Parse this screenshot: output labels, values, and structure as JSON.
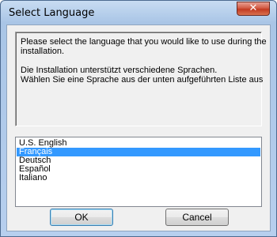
{
  "window": {
    "title": "Select Language",
    "close_glyph": "✕"
  },
  "message": {
    "line1": "Please select the language that you would like to use during the",
    "line2": "installation.",
    "line3": "Die Installation unterstützt verschiedene Sprachen.",
    "line4": "Wählen Sie eine Sprache aus der unten aufgeführten Liste aus"
  },
  "languages": {
    "items": [
      "U.S. English",
      "Français",
      "Deutsch",
      "Español",
      "Italiano"
    ],
    "selected": "Français"
  },
  "buttons": {
    "ok": "OK",
    "cancel": "Cancel"
  },
  "colors": {
    "selection": "#3399ff",
    "close_button": "#c23a22",
    "title_bar": "#a9c5e6"
  },
  "icons": {
    "close": "close-icon"
  }
}
